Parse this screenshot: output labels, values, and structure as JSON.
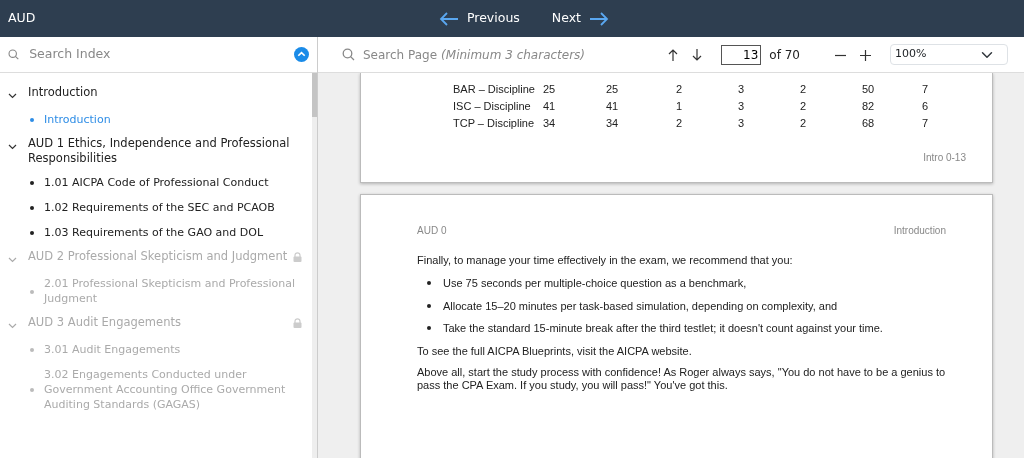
{
  "header": {
    "title": "AUD",
    "previous": "Previous",
    "next": "Next"
  },
  "sidebar": {
    "search": {
      "placeholder": "Search Index"
    },
    "sections": [
      {
        "title": "Introduction",
        "expanded": true,
        "locked": false,
        "children": [
          {
            "title": "Introduction",
            "selected": true
          }
        ]
      },
      {
        "title": "AUD 1 Ethics, Independence and Professional Responsibilities",
        "expanded": true,
        "locked": false,
        "children": [
          {
            "title": "1.01 AICPA Code of Professional Conduct",
            "selected": false
          },
          {
            "title": "1.02 Requirements of the SEC and PCAOB",
            "selected": false
          },
          {
            "title": "1.03 Requirements of the GAO and DOL",
            "selected": false
          }
        ]
      },
      {
        "title": "AUD 2 Professional Skepticism and Judgment",
        "expanded": true,
        "locked": true,
        "children": [
          {
            "title": "2.01 Professional Skepticism and Professional Judgment",
            "selected": false
          }
        ]
      },
      {
        "title": "AUD 3 Audit Engagements",
        "expanded": true,
        "locked": true,
        "children": [
          {
            "title": "3.01 Audit Engagements",
            "selected": false
          },
          {
            "title": "3.02 Engagements Conducted under Government Accounting Office Government Auditing Standards (GAGAS)",
            "selected": false
          }
        ]
      }
    ]
  },
  "toolbar": {
    "search": {
      "placeholder": "Search Page",
      "hint": "(Minimum 3 characters)"
    },
    "page_number": "13",
    "page_total": "of 70",
    "zoom": "100%"
  },
  "pages": [
    {
      "table_rows": [
        [
          "BAR – Discipline",
          "25",
          "25",
          "2",
          "3",
          "2",
          "50",
          "7"
        ],
        [
          "ISC – Discipline",
          "41",
          "41",
          "1",
          "3",
          "2",
          "82",
          "6"
        ],
        [
          "TCP – Discipline",
          "34",
          "34",
          "2",
          "3",
          "2",
          "68",
          "7"
        ]
      ],
      "footer": "Intro 0-13"
    },
    {
      "header_left": "AUD 0",
      "header_right": "Introduction",
      "blocks": [
        {
          "kind": "paragraph",
          "text": "Finally, to manage your time effectively in the exam, we recommend that you:"
        },
        {
          "kind": "list",
          "items": [
            "Use 75 seconds per multiple-choice question as a benchmark,",
            "Allocate 15–20 minutes per task-based simulation, depending on complexity, and",
            "Take the standard 15-minute break after the third testlet; it doesn't count against your time."
          ]
        },
        {
          "kind": "paragraph",
          "text": "To see the full AICPA Blueprints, visit the AICPA website."
        },
        {
          "kind": "paragraph",
          "text": "Above all, start the study process with confidence! As Roger always says, \"You do not have to be a genius to pass the CPA Exam. If you study, you will pass!\" You've got this."
        }
      ]
    }
  ]
}
